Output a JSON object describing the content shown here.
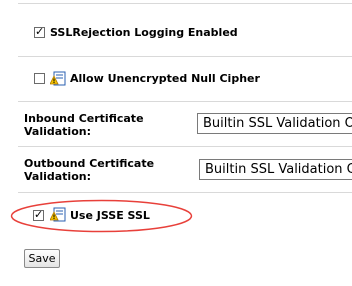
{
  "options": {
    "ssl_rejection_logging_label": "SSLRejection Logging Enabled",
    "allow_null_cipher_label": "Allow Unencrypted Null Cipher",
    "use_jsse_ssl_label": "Use JSSE SSL"
  },
  "inbound": {
    "label_line1": "Inbound Certificate",
    "label_line2": "Validation:",
    "selected_value": "Builtin SSL Validation Onl"
  },
  "outbound": {
    "label_line1": "Outbound Certificate",
    "label_line2": "Validation:",
    "selected_value": "Builtin SSL Validation Onl"
  },
  "checkbox_states": {
    "ssl_rejection_logging": true,
    "allow_null_cipher": false,
    "use_jsse_ssl": true
  },
  "actions": {
    "save_label": "Save"
  },
  "colors": {
    "highlight_oval": "#e8403a",
    "separator": "#d9d9d9"
  }
}
